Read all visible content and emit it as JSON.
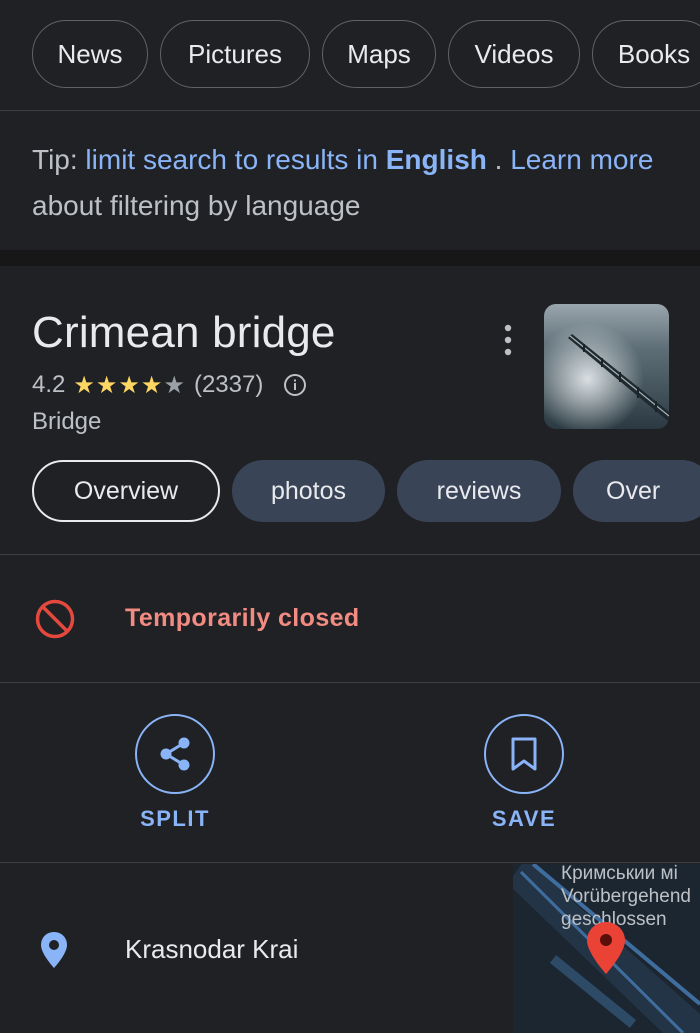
{
  "top_tabs": [
    "News",
    "Pictures",
    "Maps",
    "Videos",
    "Books"
  ],
  "tip": {
    "prefix": "Tip: ",
    "link_limit": "limit search to results in ",
    "language": "English",
    "separator": " . ",
    "link_learn": "Learn more",
    "suffix": " about filtering by language"
  },
  "place": {
    "name": "Crimean bridge",
    "rating": "4.2",
    "stars_filled": 4,
    "stars_total": 5,
    "review_count": "(2337)",
    "category": "Bridge"
  },
  "place_tabs": [
    "Overview",
    "photos",
    "reviews",
    "Over"
  ],
  "status": {
    "text": "Temporarily closed",
    "color": "#f28b82"
  },
  "actions": {
    "share_label": "SPLIT",
    "save_label": "SAVE"
  },
  "address": {
    "text": "Krasnodar Krai"
  },
  "map": {
    "label_lines": [
      "Кримськии мі",
      "Vorübergehend",
      "geschlossen"
    ]
  },
  "colors": {
    "background": "#202124",
    "accent": "#8ab4f8",
    "star": "#fdd663",
    "pin": "#ea4335"
  }
}
